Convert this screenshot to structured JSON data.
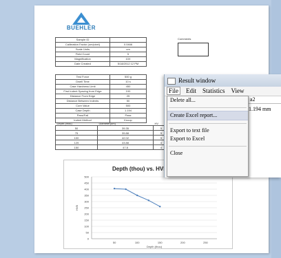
{
  "logo": {
    "text": "BUEHLER"
  },
  "params_rows": [
    [
      "Sample ID",
      ""
    ],
    [
      "Calibration Factor (um/pixel)",
      "0.0466"
    ],
    [
      "Scale Units",
      "um"
    ],
    [
      "Field Count",
      "5"
    ],
    [
      "Magnification",
      "10X"
    ],
    [
      "Date Created",
      "5/18/2012 12 PM"
    ]
  ],
  "test_rows": [
    [
      "Test Force",
      "500 g"
    ],
    [
      "Dwell Time",
      "10 s"
    ],
    [
      "Case Hardness Limit",
      "450"
    ],
    [
      "First Indent Spacing from Edge",
      "100"
    ],
    [
      "Distance From Edge",
      "25"
    ],
    [
      "Distance Between Indents",
      "50"
    ],
    [
      "Core Value",
      "500"
    ],
    [
      "Case Depth",
      "1.194"
    ],
    [
      "Pass/Fail",
      "Pass"
    ],
    [
      "Indent Method",
      "Knoop"
    ]
  ],
  "comments_label": "Comments",
  "depth_table": {
    "headers": [
      "Depth (thou)",
      "Diameter(um)",
      "HV"
    ],
    "rows": [
      [
        "50",
        "39.35",
        "5"
      ],
      [
        "75",
        "39.88",
        "5"
      ],
      [
        "100",
        "42.02",
        "5"
      ],
      [
        "125",
        "43.88",
        "4"
      ],
      [
        "150",
        "47.8",
        "4"
      ]
    ]
  },
  "chart_data": {
    "type": "line",
    "title": "Depth (thou) vs. HVB",
    "xlabel": "Depth (thou)",
    "ylabel": "HVB",
    "x": [
      50,
      75,
      100,
      125,
      150
    ],
    "series": [
      {
        "values": [
          405,
          400,
          350,
          310,
          260
        ]
      }
    ],
    "x_ticks": [
      "50",
      "100",
      "150",
      "200",
      "250"
    ],
    "y_ticks": [
      "500",
      "450",
      "400",
      "350",
      "300",
      "250",
      "200",
      "150",
      "100",
      "50",
      "0"
    ],
    "xlim": [
      0,
      275
    ],
    "ylim": [
      0,
      500
    ],
    "line_color": "#4f81bd"
  },
  "result_window": {
    "title": "Result window",
    "menu": [
      "File",
      "Edit",
      "Statistics",
      "View"
    ],
    "active_menu": "File",
    "column_header": "a2",
    "cell_value": "1.194 mm",
    "dropdown": [
      {
        "label": "Delete all...",
        "highlight": false
      },
      {
        "sep": true
      },
      {
        "label": "Create Excel report...",
        "highlight": true
      },
      {
        "sep": true
      },
      {
        "label": "Export to text file",
        "highlight": false
      },
      {
        "label": "Export to Excel",
        "highlight": false
      },
      {
        "sep": true
      },
      {
        "label": "Close",
        "highlight": false
      }
    ]
  }
}
